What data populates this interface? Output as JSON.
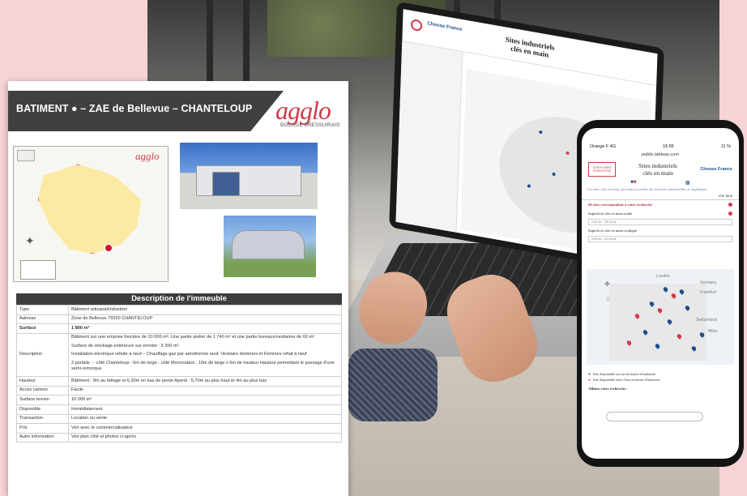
{
  "document": {
    "title": "BATIMENT ● – ZAE de Bellevue – CHANTELOUP",
    "brand": "agglo",
    "brand_sub": "BOCAGE BRESSUIRAIS",
    "map_brand": "agglo",
    "description_heading": "Description de l'immeuble",
    "rows": [
      {
        "key": "Type",
        "value": "Bâtiment artisanal/industriel"
      },
      {
        "key": "Adresse",
        "value": "Zone de Bellevue 79320 CHANTELOUP"
      },
      {
        "key": "Surface",
        "value": "1 800 m²"
      },
      {
        "key": "Description",
        "paragraphs": [
          "Bâtiment sur une emprise foncière de 10 000 m². Une partie atelier de 1 740 m² et une partie bureaux/vestiaires de 60 m².",
          "Surface de stockage extérieure sur enrobé : 3 200 m².",
          "Installation électrique refaite à neuf – Chauffage gaz par aérotherme neuf. Vestiaire Hommes et Femmes refait à neuf",
          "2 portails : - côté Chanteloup : 6m de large - côté Moncoutant : 10m de large x 6m de hauteur Hauteur permettant le passage d'une semi-remorque"
        ]
      },
      {
        "key": "Hauteur",
        "value": "Bâtiment : 9m au faîtage et 6,30m en bas de pente Apenti : 5,70m au plus haut et 4m au plus bas"
      },
      {
        "key": "Accès camion",
        "value": "Facile"
      },
      {
        "key": "Surface terrain",
        "value": "10 000 m²"
      },
      {
        "key": "Disponible",
        "value": "Immédiatement"
      },
      {
        "key": "Transaction",
        "value": "Location ou vente"
      },
      {
        "key": "Prix",
        "value": "Voir avec le commercialisateur"
      },
      {
        "key": "Autre information",
        "value": "Voir plan côté et photos ci-après"
      }
    ]
  },
  "laptop": {
    "title_line1": "Sites industriels",
    "title_line2": "clés en main",
    "choose": "Choose France"
  },
  "phone": {
    "carrier": "Orange F 4G",
    "time": "16:55",
    "battery": "11 %",
    "url": "public.tableau.com",
    "logo_text": "TERRITOIRES D'INDUSTRIE",
    "title_line1": "Sites industriels",
    "title_line2": "clés en main",
    "choose": "Choose France",
    "intro": "Ces sites clés en main, pouvant accueillir des activités industrielles et logistiques",
    "voir_plus": "Voir plus",
    "result": "94 sites correspondant à votre recherche",
    "filter1": "Superficie clés en main totale",
    "filter1_range": "0,00 ha - 725,00 ha",
    "filter2": "Superficie clés en main contiguë",
    "filter2_range": "0,00 ha - 120,00 ha",
    "map_labels": {
      "london": "London",
      "germany": "Germany",
      "frankfurt": "Frankfurt",
      "switzerland": "Switzerland",
      "milan": "Milan"
    },
    "legend1": "Site disponible sur un territoire d'industrie",
    "legend2": "Site disponible hors d'un territoire d'industrie",
    "refine": "Affinez votre recherche :"
  },
  "colors": {
    "accent": "#d13a4a",
    "navy": "#1f4d8c",
    "header": "#404040"
  }
}
